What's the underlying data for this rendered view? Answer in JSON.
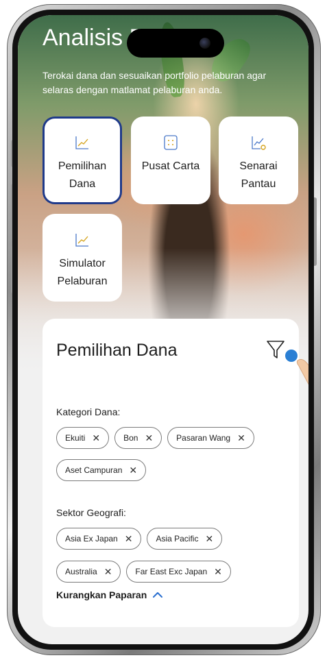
{
  "header": {
    "title": "Analisis D",
    "subtitle": "Terokai dana dan sesuaikan portfolio pelaburan agar selaras dengan matlamat pelaburan anda."
  },
  "tiles": [
    {
      "label": "Pemilihan Dana",
      "icon": "line-chart-icon",
      "active": true
    },
    {
      "label": "Pusat Carta",
      "icon": "chart-center-icon",
      "active": false
    },
    {
      "label": "Senarai Pantau",
      "icon": "watchlist-chart-icon",
      "active": false
    },
    {
      "label": "Simulator Pelaburan",
      "icon": "line-chart-icon",
      "active": false
    }
  ],
  "filter_panel": {
    "title": "Pemilihan Dana",
    "filter_icon": "funnel-icon",
    "category_label": "Kategori Dana:",
    "categories": [
      "Ekuiti",
      "Bon",
      "Pasaran Wang",
      "Aset Campuran"
    ],
    "region_label": "Sektor Geografi:",
    "regions": [
      "Asia Ex Japan",
      "Asia Pacific",
      "Australia",
      "Far East Exc Japan"
    ],
    "remove_glyph": "✕",
    "collapse_label": "Kurangkan Paparan"
  },
  "colors": {
    "accent_border": "#1f3a8a",
    "icon_blue": "#4a78c8",
    "icon_gold": "#d4a21a",
    "dot_blue": "#2a7fd4"
  }
}
